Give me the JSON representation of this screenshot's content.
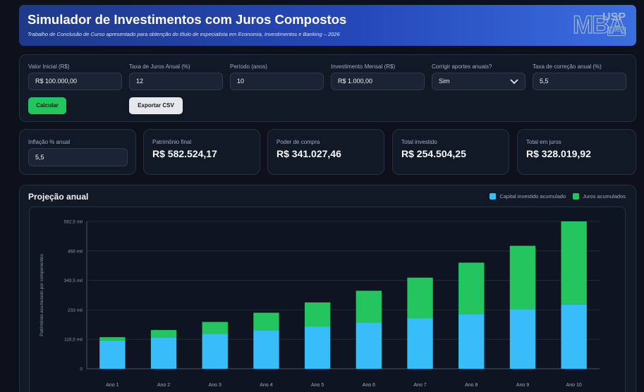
{
  "header": {
    "title": "Simulador de Investimentos com Juros Compostos",
    "subtitle": "Trabalho de Conclusão de Curso apresentado para obtenção do título de especialista em Economia, Investimentos e Banking – 2026",
    "logo_text": "MBA USP ESALQ"
  },
  "form": {
    "valor_inicial": {
      "label": "Valor Inicial (R$)",
      "value": "R$ 100.000,00"
    },
    "taxa_juros": {
      "label": "Taxa de Juros Anual (%)",
      "value": "12"
    },
    "periodo": {
      "label": "Período (anos)",
      "value": "10"
    },
    "investimento_mensal": {
      "label": "Investimento Mensal (R$)",
      "value": "R$ 1.000,00"
    },
    "corrigir_aportes": {
      "label": "Corrigir aportes anuais?",
      "value": "Sim"
    },
    "taxa_correcao": {
      "label": "Taxa de correção anual (%)",
      "value": "5,5"
    },
    "calcular_label": "Calcular",
    "exportar_label": "Exportar CSV"
  },
  "stats": {
    "inflacao": {
      "label": "Inflação % anual",
      "value": "5,5"
    },
    "patrimonio": {
      "label": "Patrimônio final",
      "value": "R$ 582.524,17"
    },
    "poder_compra": {
      "label": "Poder de compra",
      "value": "R$ 341.027,46"
    },
    "total_investido": {
      "label": "Total investido",
      "value": "R$ 254.504,25"
    },
    "total_juros": {
      "label": "Total em juros",
      "value": "R$ 328.019,92"
    }
  },
  "colors": {
    "capital": "#38bdf8",
    "juros": "#22c55e",
    "accent": "#2548b8"
  },
  "chart_data": {
    "type": "bar",
    "stacked": true,
    "title": "Projeção anual",
    "ylabel": "Patrimônio acumulado por componentes",
    "xlabel": "",
    "categories": [
      "Ano 1",
      "Ano 2",
      "Ano 3",
      "Ano 4",
      "Ano 5",
      "Ano 6",
      "Ano 7",
      "Ano 8",
      "Ano 9",
      "Ano 10"
    ],
    "yticks": [
      "0",
      "116,5 mil",
      "233 mil",
      "349,5 mil",
      "466 mil",
      "582,5 mil"
    ],
    "ylim": [
      0,
      582500
    ],
    "grid": true,
    "legend_position": "top-right",
    "series": [
      {
        "name": "Capital investido acumulado",
        "values": [
          112000,
          124700,
          138100,
          152200,
          167100,
          182800,
          199400,
          216900,
          235300,
          254500
        ]
      },
      {
        "name": "Juros acumulados",
        "values": [
          12800,
          28300,
          46900,
          69200,
          95100,
          125500,
          160700,
          202500,
          250700,
          328000
        ]
      }
    ]
  }
}
